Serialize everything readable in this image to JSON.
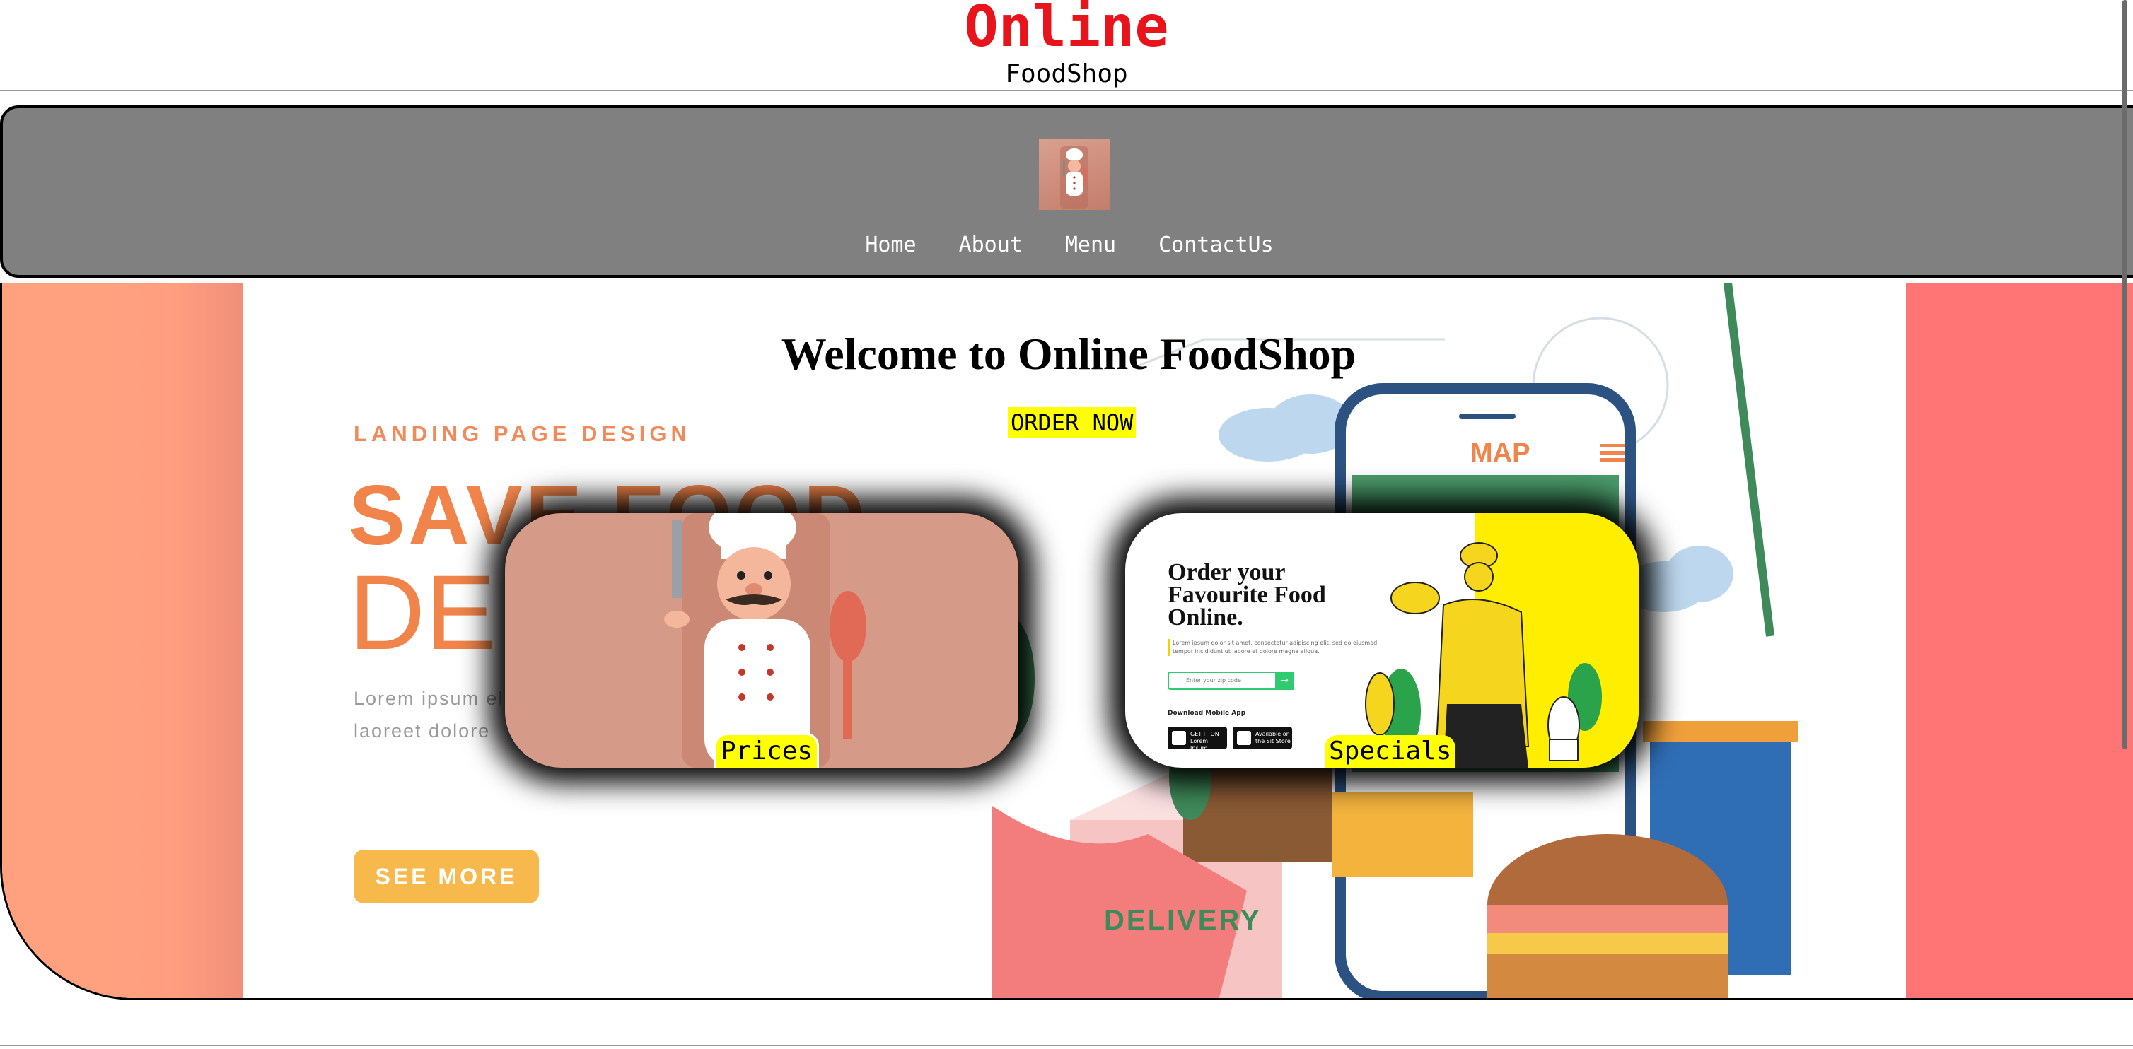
{
  "header": {
    "title": "Online",
    "subtitle": "FoodShop"
  },
  "nav": {
    "logo_icon": "chef-logo-icon",
    "links": [
      "Home",
      "About",
      "Menu",
      "ContactUs"
    ]
  },
  "hero": {
    "heading": "Welcome to Online FoodShop",
    "order_now": "ORDER NOW",
    "background_art": {
      "label": "LANDING PAGE DESIGN",
      "headline_1": "SAVE FOOD",
      "headline_2": "DE",
      "body": "Lorem ipsum elit, sed diam laoreet dolore",
      "button": "SEE MORE",
      "map_label": "MAP",
      "delivery_label": "DELIVERY"
    },
    "cards": [
      {
        "label": "Prices",
        "image_icon": "chef-mascot-icon"
      },
      {
        "label": "Specials",
        "image_icon": "chef-serving-icon",
        "art_heading": "Order your Favourite Food Online.",
        "art_desc": "Lorem ipsum dolor sit amet, consectetur adipiscing elit, sed do eiusmod tempor incididunt ut labore et dolore magna aliqua.",
        "art_input": "Enter your zip code",
        "art_download": "Download Mobile App",
        "art_store_1": "GET IT ON Lorem Ipsum",
        "art_store_2": "Available on the Sit Store"
      }
    ]
  },
  "colors": {
    "title_red": "#e8131b",
    "nav_gray": "#808080",
    "highlight_yellow": "#ffff00",
    "hero_peach": "#ffa17e",
    "hero_coral": "#ff7575"
  }
}
